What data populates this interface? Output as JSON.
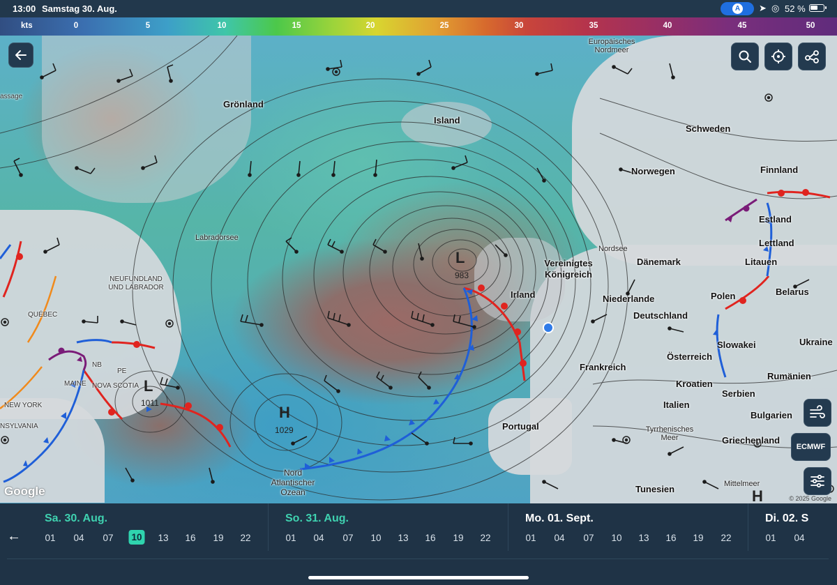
{
  "status": {
    "time": "13:00",
    "date": "Samstag 30. Aug.",
    "battery": "52 %",
    "nav_badge": "A"
  },
  "scale": {
    "unit": "kts",
    "ticks": [
      "0",
      "5",
      "10",
      "15",
      "20",
      "25",
      "30",
      "35",
      "40",
      "45",
      "50"
    ]
  },
  "map": {
    "labels": {
      "groenland": "Grönland",
      "island": "Island",
      "europ_nordmeer": "Europäisches Nordmeer",
      "schweden": "Schweden",
      "finnland": "Finnland",
      "norwegen": "Norwegen",
      "estland": "Estland",
      "lettland": "Lettland",
      "litauen": "Litauen",
      "daenemark": "Dänemark",
      "nordsee": "Nordsee",
      "vk": "Vereinigtes Königreich",
      "irland": "Irland",
      "niederlande": "Niederlande",
      "deutschland": "Deutschland",
      "polen": "Polen",
      "belarus": "Belarus",
      "ukraine": "Ukraine",
      "slowakei": "Slowakei",
      "oesterreich": "Österreich",
      "frankreich": "Frankreich",
      "kroatien": "Kroatien",
      "rumaenien": "Rumänien",
      "serbien": "Serbien",
      "italien": "Italien",
      "bulgarien": "Bulgarien",
      "portugal": "Portugal",
      "griechenland": "Griechenland",
      "tyrrh": "Tyrrhenisches Meer",
      "tunesien": "Tunesien",
      "mittelmeer": "Mittelmeer",
      "labradorsee": "Labradorsee",
      "neufundland": "NEUFUNDLAND UND LABRADOR",
      "quebec": "QUÉBEC",
      "newyork": "NEW YORK",
      "maine": "MAINE",
      "novascotia": "NOVA SCOTIA",
      "nb": "NB",
      "pe": "PE",
      "sylvania": "NSYLVANIA",
      "passage": "assage",
      "nordatl": "Nord Atlantischer Ozean"
    },
    "pressure": {
      "l1": "L",
      "l1_val": "983",
      "l2": "L",
      "l2_val": "1011",
      "h1": "H",
      "h1_val": "1029",
      "h2": "H"
    },
    "attribution": "Google",
    "copyright": "© 2025 Google",
    "model_button": "ECMWF"
  },
  "timeline": {
    "days": [
      {
        "label": "Sa. 30. Aug.",
        "hours": [
          "01",
          "04",
          "07",
          "10",
          "13",
          "16",
          "19",
          "22"
        ],
        "active": true,
        "selected_hour": "10"
      },
      {
        "label": "So. 31. Aug.",
        "hours": [
          "01",
          "04",
          "07",
          "10",
          "13",
          "16",
          "19",
          "22"
        ],
        "active": true
      },
      {
        "label": "Mo. 01. Sept.",
        "hours": [
          "01",
          "04",
          "07",
          "10",
          "13",
          "16",
          "19",
          "22"
        ],
        "active": false
      },
      {
        "label": "Di. 02. S",
        "hours": [
          "01",
          "04"
        ],
        "active": false
      }
    ]
  }
}
